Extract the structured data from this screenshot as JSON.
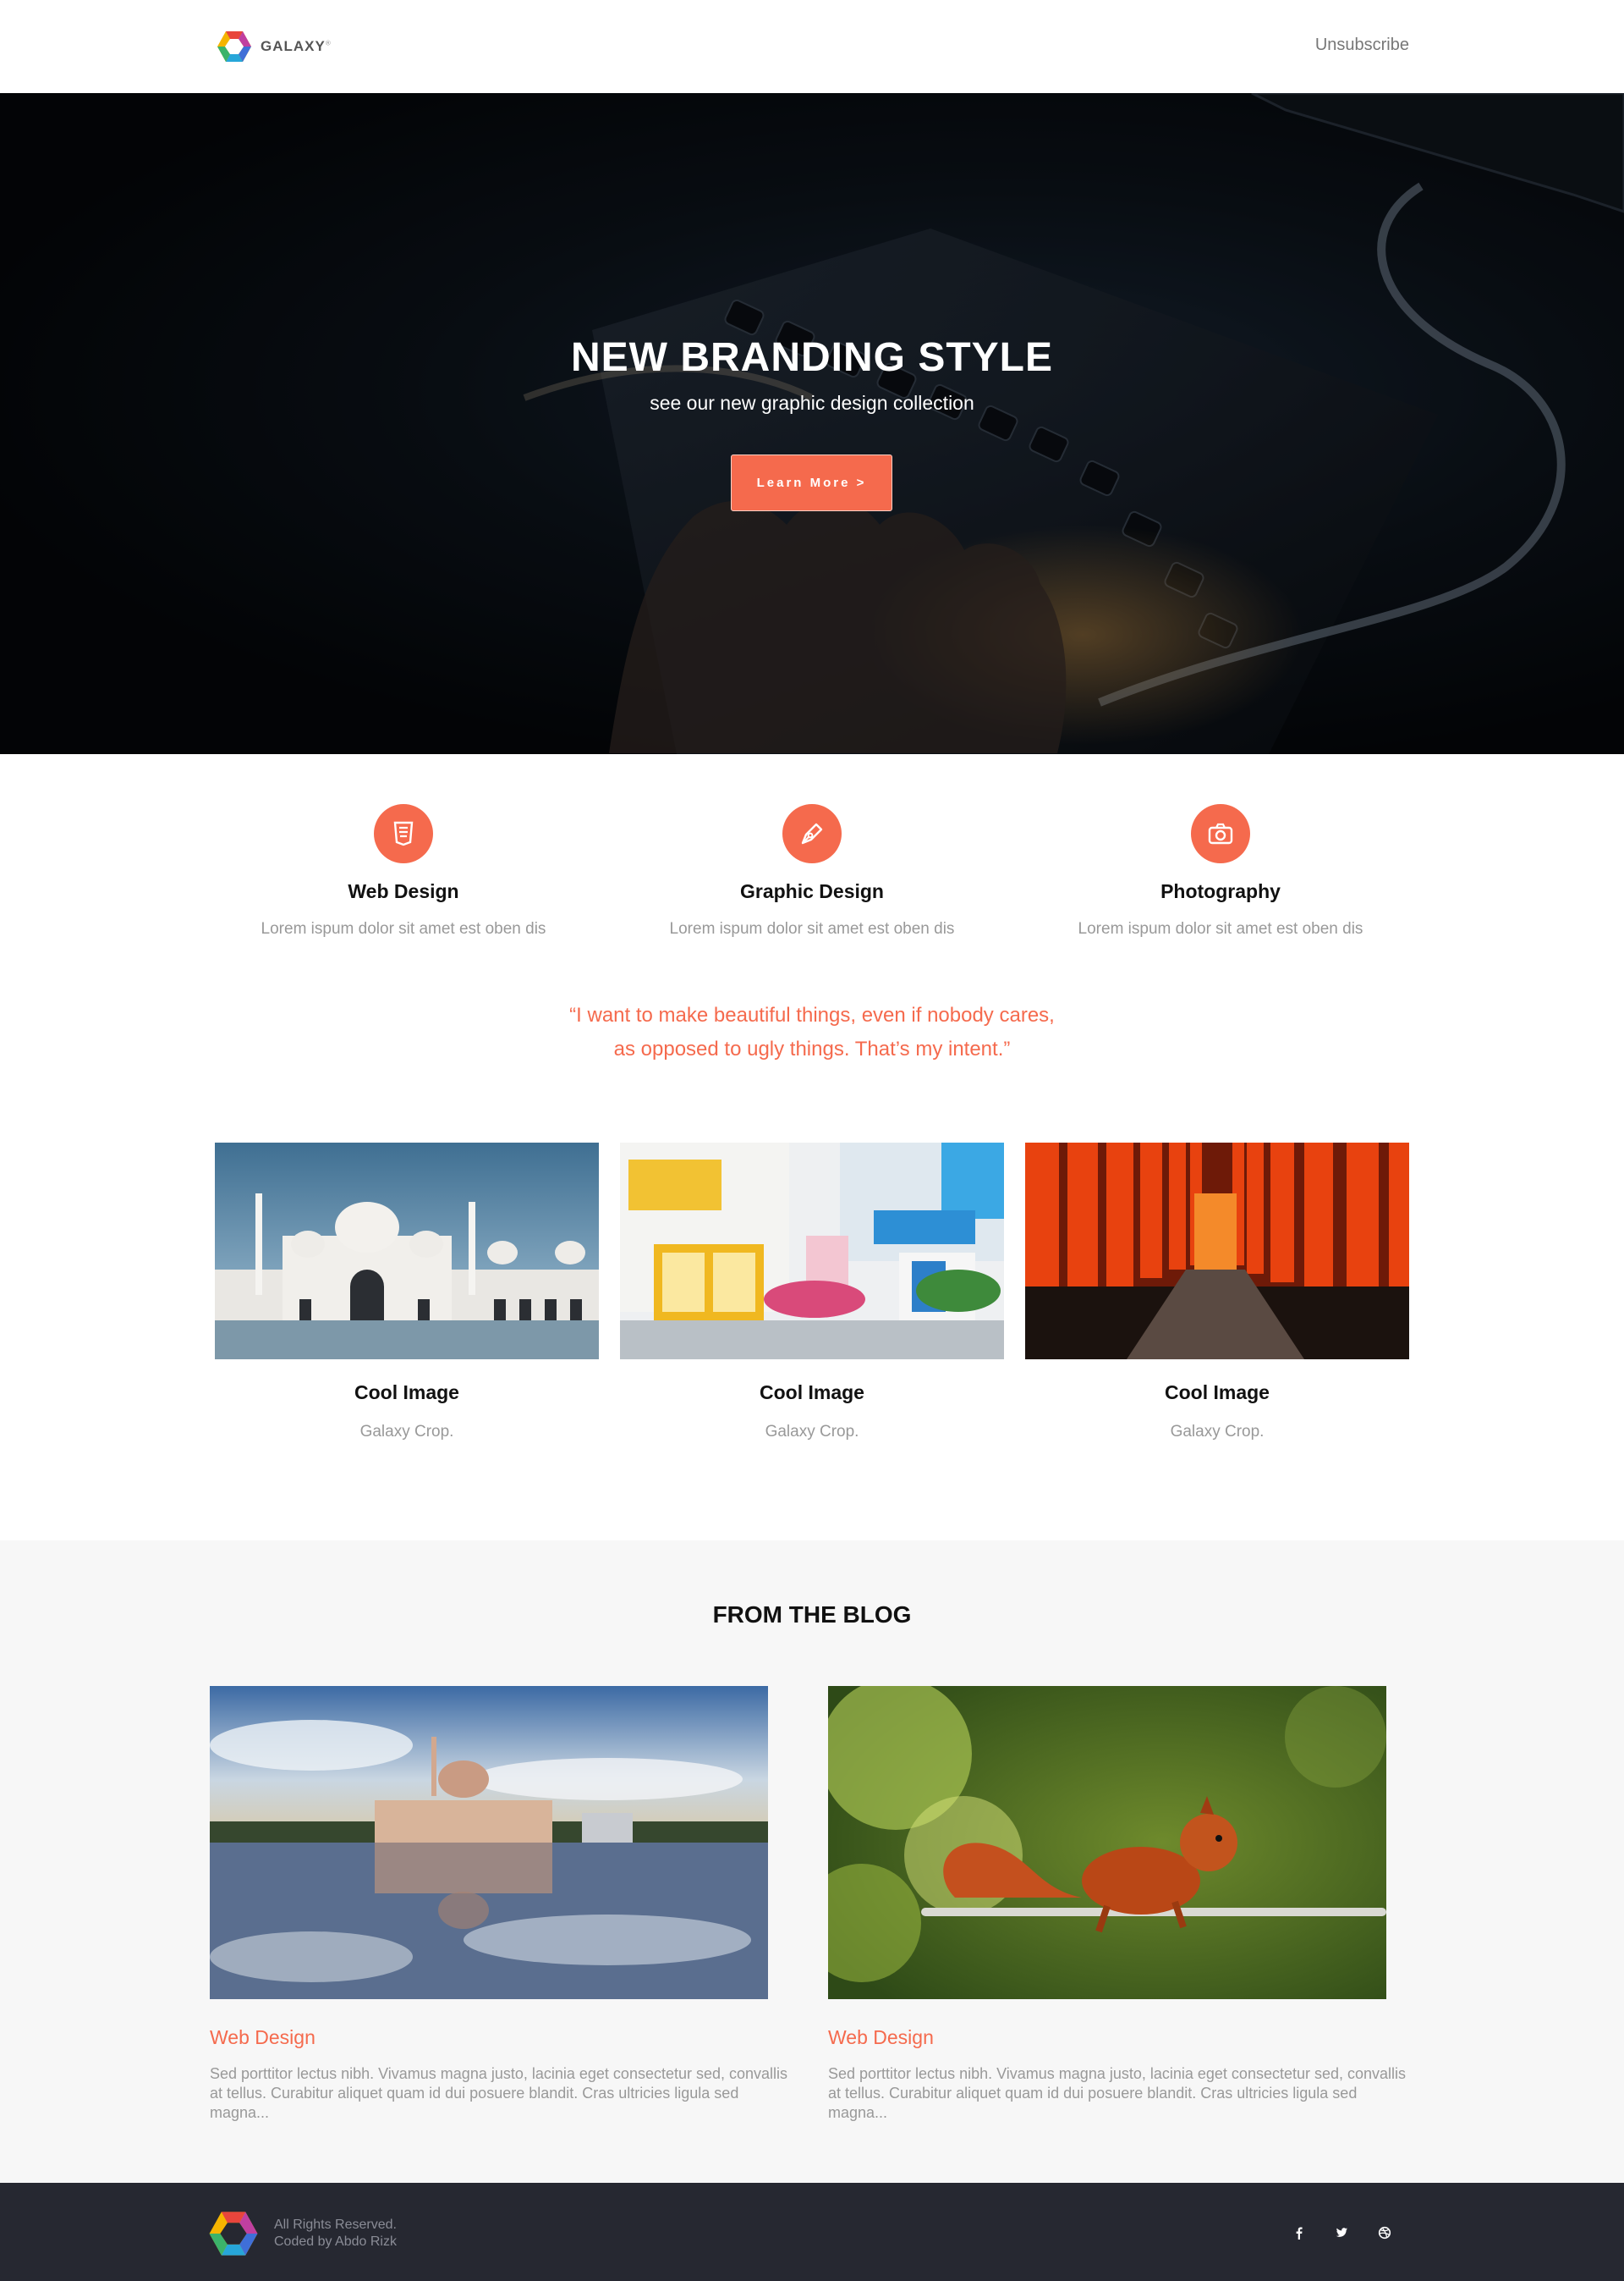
{
  "header": {
    "brand": "GALAXY",
    "brand_mark": "®",
    "unsubscribe": "Unsubscribe"
  },
  "hero": {
    "title": "NEW BRANDING STYLE",
    "subtitle": "see our new graphic design collection",
    "button": "Learn More >"
  },
  "services": [
    {
      "icon": "html5-icon",
      "title": "Web Design",
      "desc": "Lorem ispum dolor sit amet est oben dis"
    },
    {
      "icon": "pen-nib-icon",
      "title": "Graphic Design",
      "desc": "Lorem ispum dolor sit amet est oben dis"
    },
    {
      "icon": "camera-icon",
      "title": "Photography",
      "desc": "Lorem ispum dolor sit amet est oben dis"
    }
  ],
  "quote": {
    "line1": "“I want to make beautiful things, even if nobody cares,",
    "line2": "as opposed to ugly things. That’s my intent.”"
  },
  "gallery": [
    {
      "image": "mosque-white-domes",
      "title": "Cool Image",
      "sub": "Galaxy Crop."
    },
    {
      "image": "colorful-street-balconies",
      "title": "Cool Image",
      "sub": "Galaxy Crop."
    },
    {
      "image": "red-torii-gates-path",
      "title": "Cool Image",
      "sub": "Galaxy Crop."
    }
  ],
  "blog": {
    "heading": "FROM THE BLOG",
    "posts": [
      {
        "image": "pink-mosque-lake-reflection",
        "category": "Web Design",
        "excerpt": "Sed porttitor lectus nibh. Vivamus magna justo, lacinia eget consectetur sed, convallis at tellus. Curabitur aliquet quam id dui posuere blandit. Cras ultricies ligula sed magna..."
      },
      {
        "image": "red-squirrel-on-rail",
        "category": "Web Design",
        "excerpt": "Sed porttitor lectus nibh. Vivamus magna justo, lacinia eget consectetur sed, convallis at tellus. Curabitur aliquet quam id dui posuere blandit. Cras ultricies ligula sed magna..."
      }
    ]
  },
  "footer": {
    "rights": "All Rights Reserved.",
    "credit": "Coded by Abdo Rizk",
    "social": [
      "facebook-icon",
      "twitter-icon",
      "dribbble-icon"
    ]
  },
  "colors": {
    "accent": "#f56a4d",
    "footer_bg": "#262831",
    "blog_bg": "#f7f7f7"
  }
}
